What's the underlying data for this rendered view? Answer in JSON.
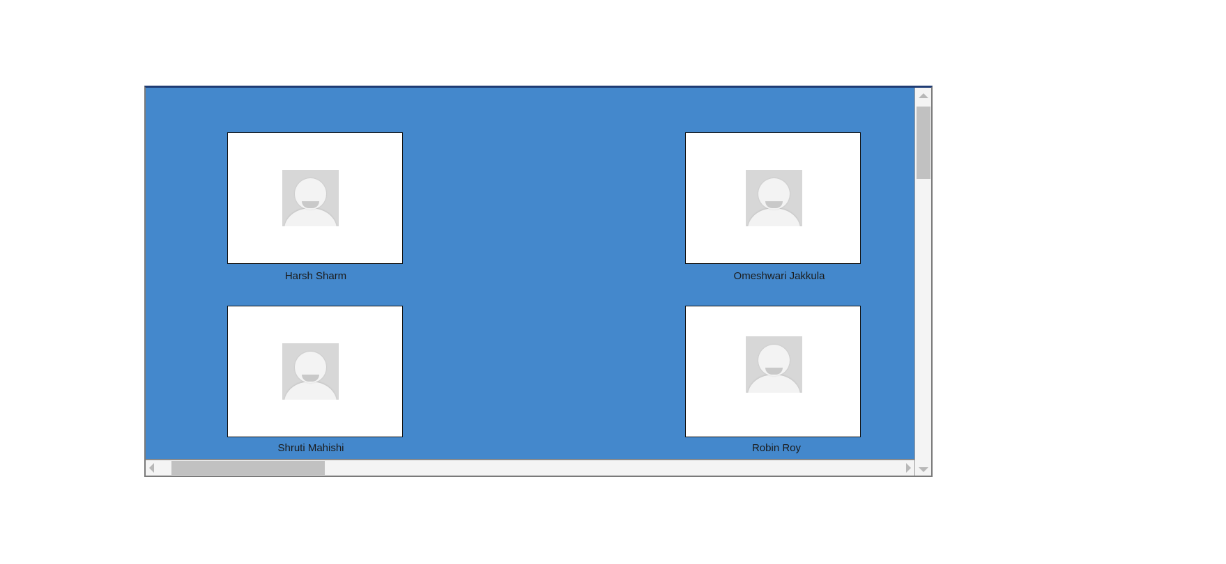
{
  "panel": {
    "background_color": "#4488cc",
    "participants": [
      {
        "name": "Harsh Sharm",
        "avatar_icon": "default-user-avatar-icon"
      },
      {
        "name": "Omeshwari Jakkula",
        "avatar_icon": "default-user-avatar-icon"
      },
      {
        "name": "Shruti Mahishi",
        "avatar_icon": "default-user-avatar-icon"
      },
      {
        "name": "Robin Roy",
        "avatar_icon": "default-user-avatar-icon"
      }
    ]
  }
}
